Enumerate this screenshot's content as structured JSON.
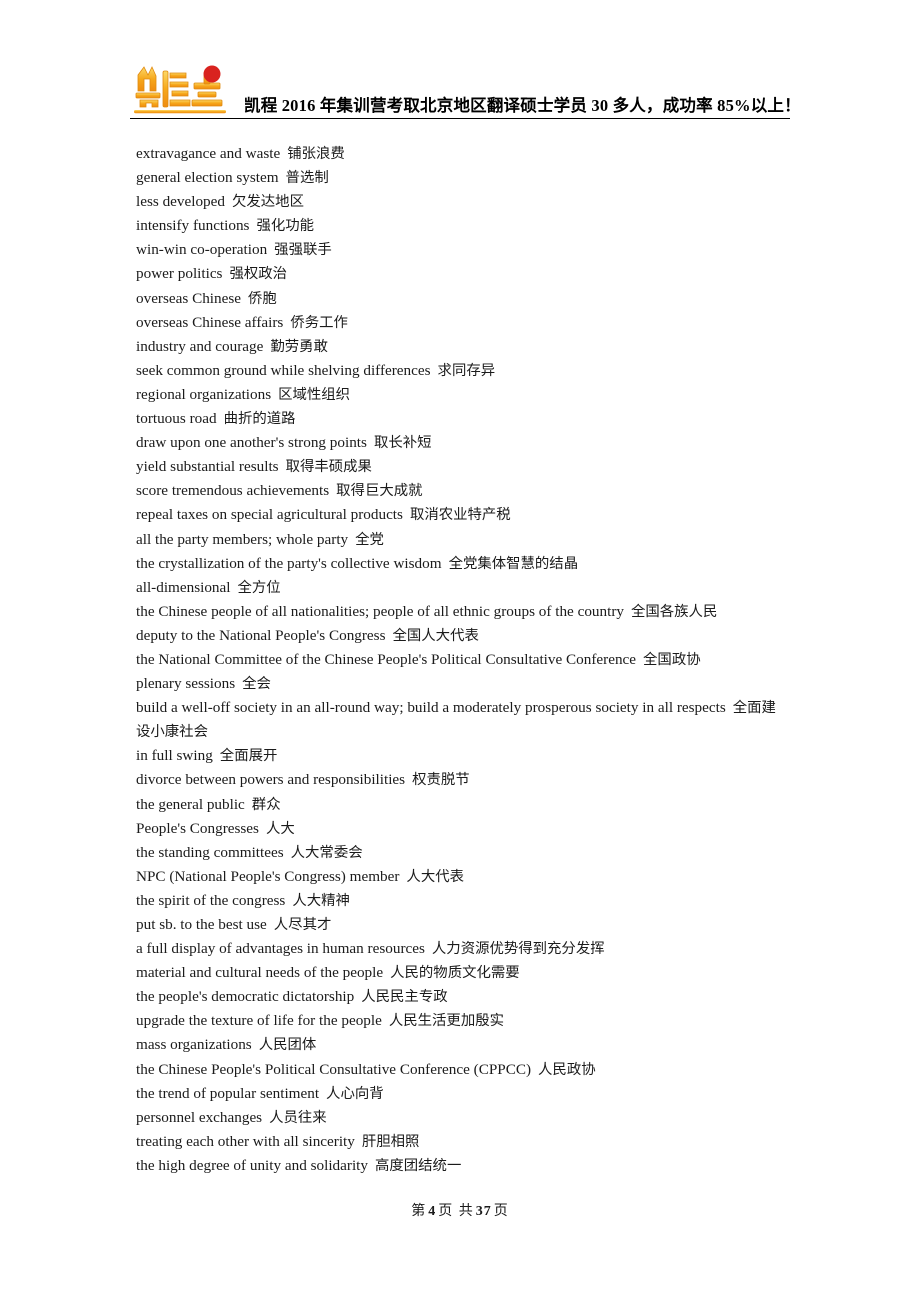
{
  "document": {
    "header": {
      "logo_alt": "kaicheng-logo",
      "title": "凯程 2016 年集训营考取北京地区翻译硕士学员 30 多人，成功率 85%以上！"
    },
    "footer": {
      "prefix": "第",
      "current_page": "4",
      "middle": "页 共",
      "total_pages": "37",
      "suffix": "页"
    },
    "glossary": [
      {
        "en": "extravagance and waste",
        "cn": "铺张浪费"
      },
      {
        "en": "general election system",
        "cn": "普选制"
      },
      {
        "en": "less developed",
        "cn": "欠发达地区"
      },
      {
        "en": "intensify functions",
        "cn": "强化功能"
      },
      {
        "en": "win-win co-operation",
        "cn": "强强联手"
      },
      {
        "en": "power politics",
        "cn": "强权政治"
      },
      {
        "en": "overseas Chinese",
        "cn": "侨胞"
      },
      {
        "en": "overseas Chinese affairs",
        "cn": "侨务工作"
      },
      {
        "en": "industry and courage",
        "cn": "勤劳勇敢"
      },
      {
        "en": "seek common ground while shelving differences",
        "cn": "求同存异"
      },
      {
        "en": "regional organizations",
        "cn": "区域性组织"
      },
      {
        "en": "tortuous road",
        "cn": "曲折的道路"
      },
      {
        "en": "draw upon one another's strong points",
        "cn": "取长补短"
      },
      {
        "en": "yield substantial results",
        "cn": "取得丰硕成果"
      },
      {
        "en": "score tremendous achievements",
        "cn": "取得巨大成就"
      },
      {
        "en": "repeal taxes on special agricultural products",
        "cn": "取消农业特产税"
      },
      {
        "en": "all the party members; whole party",
        "cn": "全党"
      },
      {
        "en": "the crystallization of the party's collective wisdom",
        "cn": "全党集体智慧的结晶"
      },
      {
        "en": "all-dimensional",
        "cn": "全方位"
      },
      {
        "en": "the Chinese people of all nationalities; people of all ethnic groups of the country",
        "cn": "全国各族人民"
      },
      {
        "en": "deputy to the National People's Congress",
        "cn": "全国人大代表"
      },
      {
        "en": "the National Committee of the Chinese People's Political Consultative Conference",
        "cn": "全国政协"
      },
      {
        "en": "plenary sessions",
        "cn": "全会"
      },
      {
        "en": "build a well-off society in an all-round way; build a moderately prosperous society in all respects",
        "cn": "全面建设小康社会"
      },
      {
        "en": "in full swing",
        "cn": "全面展开"
      },
      {
        "en": "divorce between powers and responsibilities",
        "cn": "权责脱节"
      },
      {
        "en": "the general public",
        "cn": "群众"
      },
      {
        "en": "People's Congresses",
        "cn": "人大"
      },
      {
        "en": "the standing committees",
        "cn": "人大常委会"
      },
      {
        "en": "NPC (National People's Congress) member",
        "cn": "人大代表"
      },
      {
        "en": "the spirit of the congress",
        "cn": "人大精神"
      },
      {
        "en": "put sb. to the best use",
        "cn": "人尽其才"
      },
      {
        "en": "a full display of advantages in human resources",
        "cn": "人力资源优势得到充分发挥"
      },
      {
        "en": "material and cultural needs of the people",
        "cn": "人民的物质文化需要"
      },
      {
        "en": "the people's democratic dictatorship",
        "cn": "人民民主专政"
      },
      {
        "en": "upgrade the texture of life for the people",
        "cn": "人民生活更加殷实"
      },
      {
        "en": "mass organizations",
        "cn": "人民团体"
      },
      {
        "en": "the Chinese People's Political Consultative Conference (CPPCC)",
        "cn": "人民政协"
      },
      {
        "en": "the trend of popular sentiment",
        "cn": "人心向背"
      },
      {
        "en": "personnel exchanges",
        "cn": "人员往来"
      },
      {
        "en": "treating each other with all sincerity",
        "cn": "肝胆相照"
      },
      {
        "en": "the high degree of unity and solidarity",
        "cn": "高度团结统一"
      }
    ],
    "colors": {
      "logo_orange": "#f5a11e",
      "logo_yellow": "#fbd35a",
      "logo_red": "#d9231f",
      "text": "#1b1b1b",
      "rule": "#000000"
    }
  }
}
